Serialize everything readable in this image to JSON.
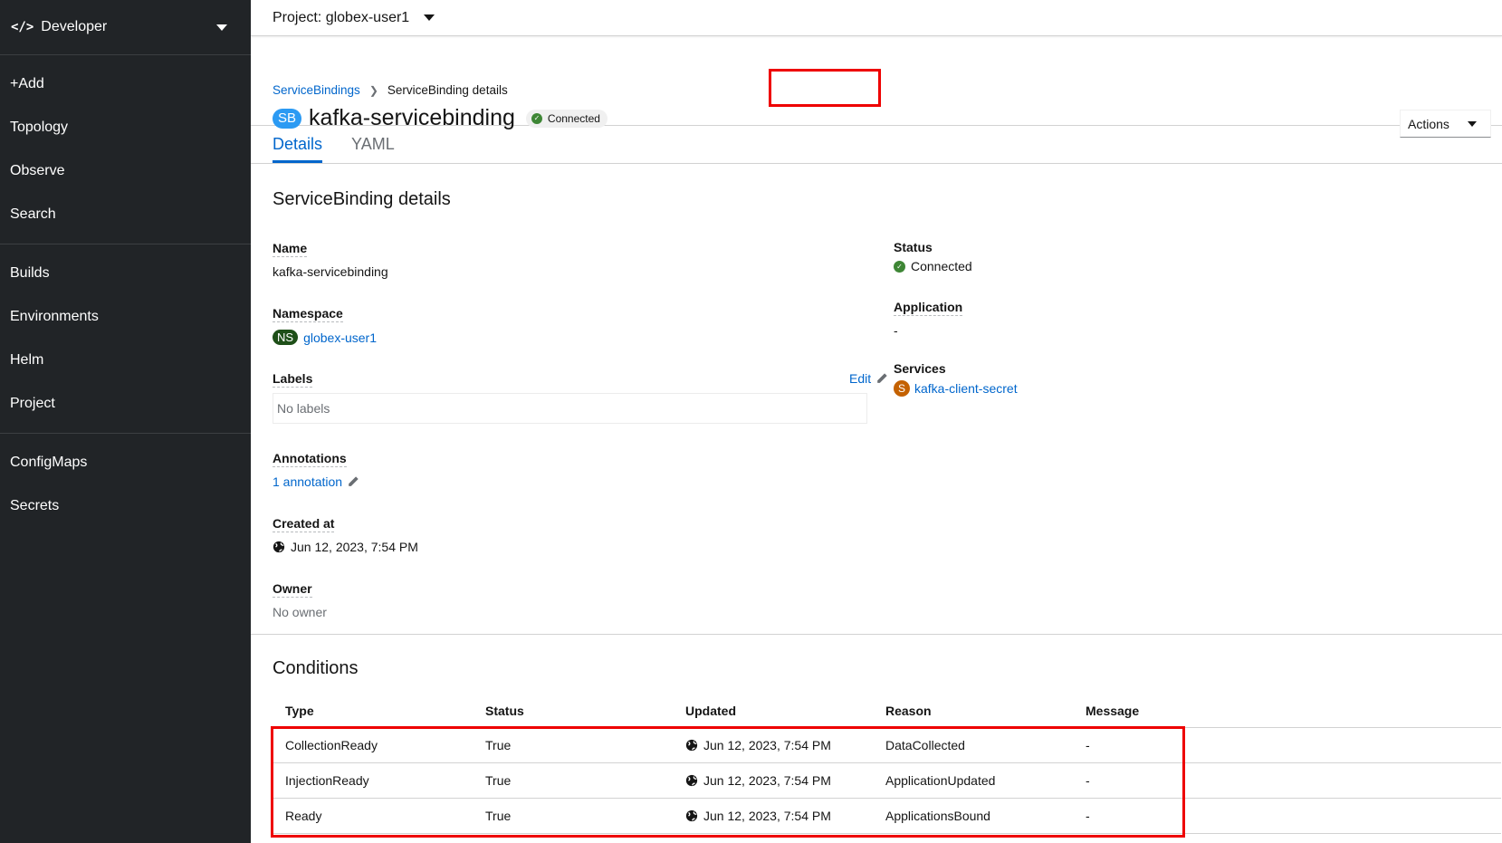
{
  "sidebar": {
    "perspective": {
      "icon": "code-icon",
      "label": "Developer"
    },
    "groups": [
      [
        "+Add",
        "Topology",
        "Observe",
        "Search"
      ],
      [
        "Builds",
        "Environments",
        "Helm",
        "Project"
      ],
      [
        "ConfigMaps",
        "Secrets"
      ]
    ]
  },
  "topbar": {
    "project_label": "Project: globex-user1"
  },
  "header": {
    "breadcrumb": [
      "ServiceBindings",
      "ServiceBinding details"
    ],
    "badge": "SB",
    "title": "kafka-servicebinding",
    "status": "Connected",
    "actions_label": "Actions"
  },
  "tabs": [
    "Details",
    "YAML"
  ],
  "details": {
    "section_title": "ServiceBinding details",
    "name_label": "Name",
    "name_value": "kafka-servicebinding",
    "namespace_label": "Namespace",
    "namespace_badge": "NS",
    "namespace_value": "globex-user1",
    "labels_label": "Labels",
    "labels_edit": "Edit",
    "labels_value": "No labels",
    "annotations_label": "Annotations",
    "annotations_value": "1 annotation",
    "created_label": "Created at",
    "created_value": "Jun 12, 2023, 7:54 PM",
    "owner_label": "Owner",
    "owner_value": "No owner",
    "status_label": "Status",
    "status_value": "Connected",
    "application_label": "Application",
    "application_value": "-",
    "services_label": "Services",
    "services_badge": "S",
    "services_value": "kafka-client-secret"
  },
  "conditions": {
    "title": "Conditions",
    "columns": [
      "Type",
      "Status",
      "Updated",
      "Reason",
      "Message"
    ],
    "rows": [
      {
        "type": "CollectionReady",
        "status": "True",
        "updated": "Jun 12, 2023, 7:54 PM",
        "reason": "DataCollected",
        "message": "-"
      },
      {
        "type": "InjectionReady",
        "status": "True",
        "updated": "Jun 12, 2023, 7:54 PM",
        "reason": "ApplicationUpdated",
        "message": "-"
      },
      {
        "type": "Ready",
        "status": "True",
        "updated": "Jun 12, 2023, 7:54 PM",
        "reason": "ApplicationsBound",
        "message": "-"
      }
    ]
  },
  "colors": {
    "link": "#0066cc",
    "success": "#3e8635",
    "sidebar_bg": "#212427",
    "highlight": "#ee0000"
  }
}
